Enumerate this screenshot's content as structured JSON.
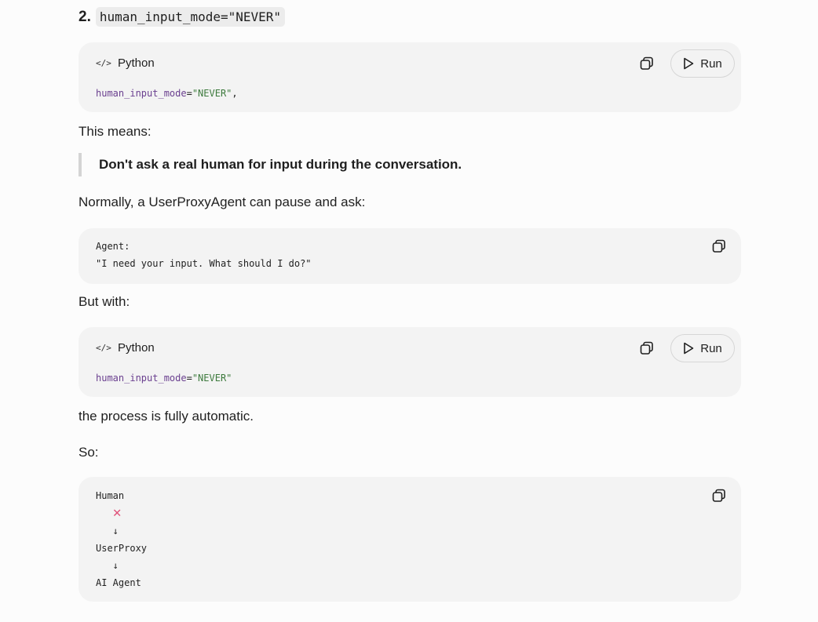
{
  "heading": {
    "number": "2.",
    "code": "human_input_mode=\"NEVER\""
  },
  "block1": {
    "lang": "Python",
    "run_label": "Run",
    "code_name": "human_input_mode",
    "code_op": "=",
    "code_str": "\"NEVER\"",
    "code_tail": ","
  },
  "para1": "This means:",
  "quote": "Don't ask a real human for input during the conversation.",
  "para2": "Normally, a UserProxyAgent can pause and ask:",
  "block2": {
    "line1": "Agent:",
    "line2": "\"I need your input. What should I do?\""
  },
  "para3": "But with:",
  "block3": {
    "lang": "Python",
    "run_label": "Run",
    "code_name": "human_input_mode",
    "code_op": "=",
    "code_str": "\"NEVER\""
  },
  "para4": "the process is fully automatic.",
  "para5": "So:",
  "block4": {
    "line1": "Human",
    "line2": "✕",
    "line3": "   ↓",
    "line4": "UserProxy",
    "line5": "   ↓",
    "line6": "AI Agent"
  },
  "icons": {
    "code": "code-icon",
    "copy": "copy-icon",
    "play": "play-icon"
  },
  "colors": {
    "background": "#fcfcfc",
    "block": "#f3f3f3",
    "keyword": "#6a3f8f",
    "string": "#3d7a3d",
    "cross": "#e0527a"
  }
}
